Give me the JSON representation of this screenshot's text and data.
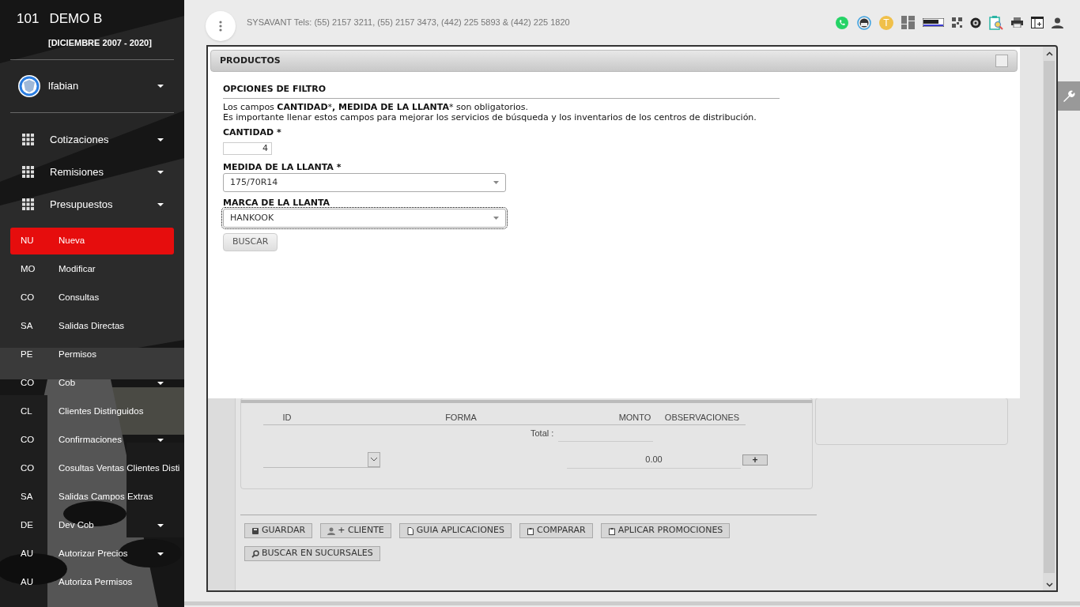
{
  "sidebar": {
    "company_number": "101",
    "company_name": "DEMO B",
    "period": "[DICIEMBRE 2007 - 2020]",
    "user": "lfabian",
    "menus": [
      {
        "label": "Cotizaciones"
      },
      {
        "label": "Remisiones"
      },
      {
        "label": "Presupuestos"
      }
    ],
    "items": [
      {
        "abbr": "NU",
        "label": "Nueva",
        "selected": true,
        "has_submenu": false
      },
      {
        "abbr": "MO",
        "label": "Modificar",
        "selected": false,
        "has_submenu": false
      },
      {
        "abbr": "CO",
        "label": "Consultas",
        "selected": false,
        "has_submenu": false
      },
      {
        "abbr": "SA",
        "label": "Salidas Directas",
        "selected": false,
        "has_submenu": false
      },
      {
        "abbr": "PE",
        "label": "Permisos",
        "selected": false,
        "has_submenu": false
      },
      {
        "abbr": "CO",
        "label": "Cob",
        "selected": false,
        "has_submenu": true
      },
      {
        "abbr": "CL",
        "label": "Clientes Distinguidos",
        "selected": false,
        "has_submenu": false
      },
      {
        "abbr": "CO",
        "label": "Confirmaciones",
        "selected": false,
        "has_submenu": true
      },
      {
        "abbr": "CO",
        "label": "Cosultas Ventas Clientes Disti",
        "selected": false,
        "has_submenu": false
      },
      {
        "abbr": "SA",
        "label": "Salidas Campos Extras",
        "selected": false,
        "has_submenu": false
      },
      {
        "abbr": "DE",
        "label": "Dev Cob",
        "selected": false,
        "has_submenu": true
      },
      {
        "abbr": "AU",
        "label": "Autorizar Precios",
        "selected": false,
        "has_submenu": true
      },
      {
        "abbr": "AU",
        "label": "Autoriza Permisos",
        "selected": false,
        "has_submenu": false
      }
    ]
  },
  "header": {
    "contact": "SYSAVANT Tels: (55) 2157 3211, (55) 2157 3473, (442) 225 5893 & (442) 225 1820",
    "avatar_letter": "T"
  },
  "dialog": {
    "title": "PRODUCTOS",
    "section": "OPCIONES DE FILTRO",
    "note": [
      {
        "text": "Los campos ",
        "bold": false
      },
      {
        "text": "CANTIDAD",
        "bold": true
      },
      {
        "text": "*",
        "bold": false
      },
      {
        "text": ", MEDIDA DE LA LLANTA",
        "bold": true
      },
      {
        "text": "* son obligatorios.",
        "bold": false
      }
    ],
    "note_2": "Es importante llenar estos campos para mejorar los servicios de búsqueda y los inventarios de los centros de distribución.",
    "quantity": {
      "label": "CANTIDAD *",
      "value": "4"
    },
    "selects": [
      {
        "label": "MEDIDA DE LA LLANTA *",
        "value": "175/70R14",
        "focused": false
      },
      {
        "label": "MARCA DE LA LLANTA",
        "value": "HANKOOK",
        "focused": true
      }
    ],
    "search_button": "BUSCAR"
  },
  "payments": {
    "columns": [
      "ID",
      "FORMA",
      "MONTO",
      "OBSERVACIONES"
    ],
    "total_label": "Total :",
    "amount": "0.00",
    "add_button": "+"
  },
  "buttons": [
    {
      "kind": "save",
      "label": "GUARDAR"
    },
    {
      "kind": "user",
      "label": "+ CLIENTE"
    },
    {
      "kind": "doc",
      "label": "GUIA APLICACIONES"
    },
    {
      "kind": "clipboard",
      "label": "COMPARAR"
    },
    {
      "kind": "clipboard",
      "label": "APLICAR PROMOCIONES"
    },
    {
      "kind": "search",
      "label": "BUSCAR EN SUCURSALES"
    }
  ]
}
